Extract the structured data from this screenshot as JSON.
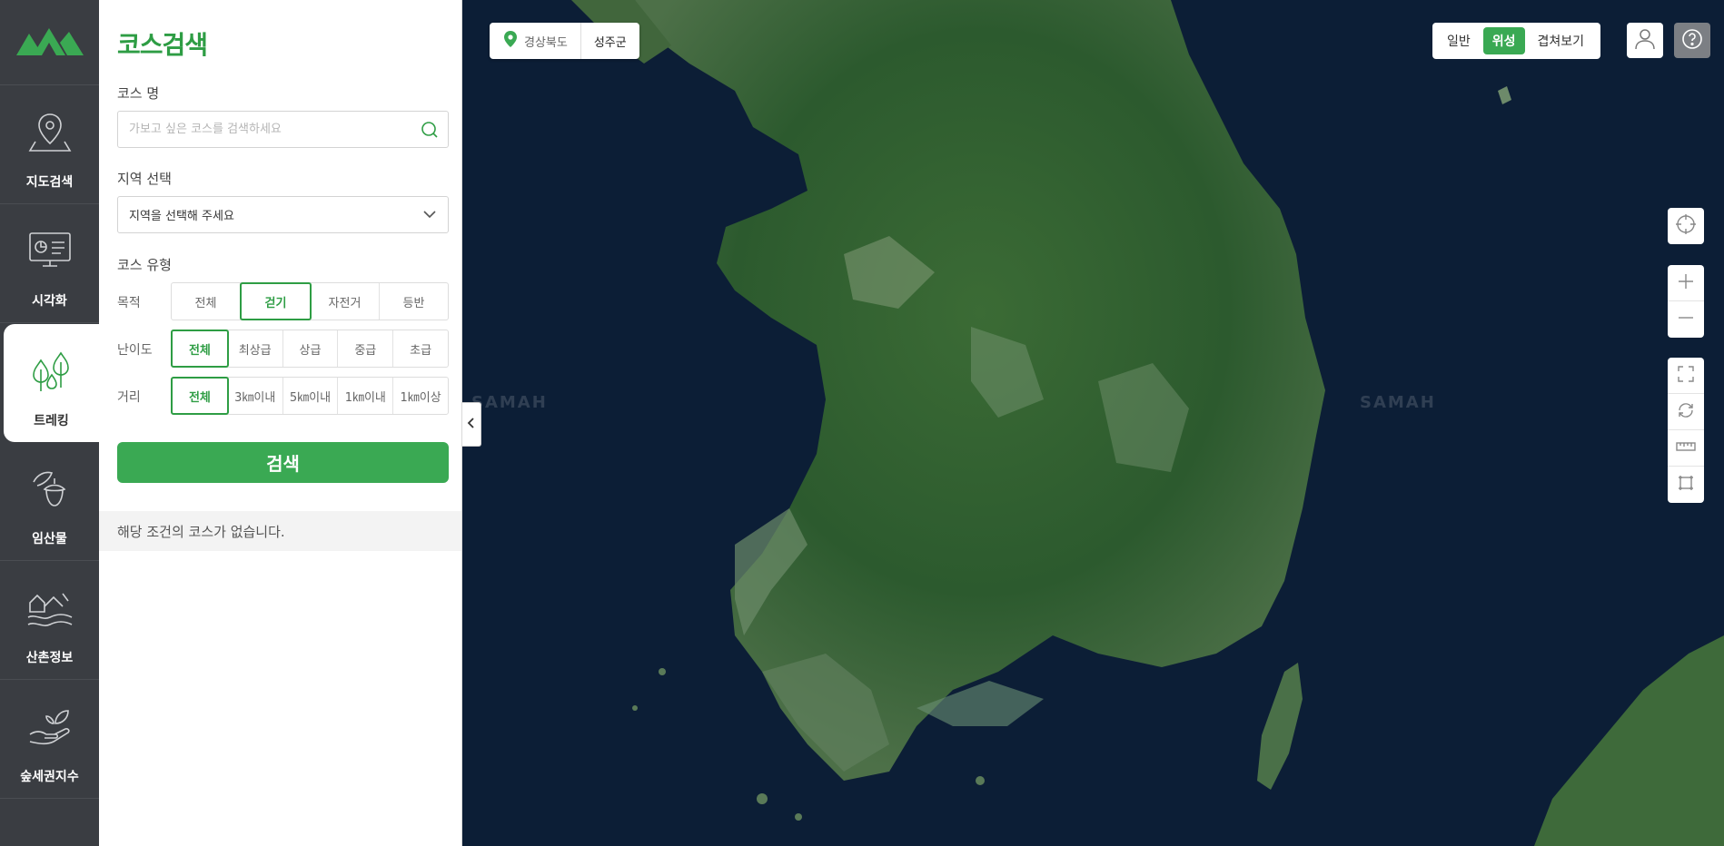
{
  "nav": {
    "items": [
      {
        "label": "지도검색",
        "icon": "map-pin-icon"
      },
      {
        "label": "시각화",
        "icon": "monitor-chart-icon"
      },
      {
        "label": "트레킹",
        "icon": "trees-icon"
      },
      {
        "label": "임산물",
        "icon": "acorn-icon"
      },
      {
        "label": "산촌정보",
        "icon": "village-icon"
      },
      {
        "label": "숲세권지수",
        "icon": "hand-leaf-icon"
      }
    ],
    "active": "트레킹"
  },
  "panel": {
    "title": "코스검색",
    "course_name_label": "코스 명",
    "course_name_placeholder": "가보고 싶은 코스를 검색하세요",
    "region_label": "지역 선택",
    "region_value": "지역을 선택해 주세요",
    "course_type_label": "코스 유형",
    "purpose": {
      "label": "목적",
      "options": [
        "전체",
        "걷기",
        "자전거",
        "등반"
      ],
      "selected": "걷기"
    },
    "difficulty": {
      "label": "난이도",
      "options": [
        "전체",
        "최상급",
        "상급",
        "중급",
        "초급"
      ],
      "selected": "전체"
    },
    "distance": {
      "label": "거리",
      "options": [
        "전체",
        "3㎞이내",
        "5㎞이내",
        "1㎞이내",
        "1㎞이상"
      ],
      "selected": "전체"
    },
    "search_button": "검색",
    "result_text": "해당 조건의 코스가 없습니다."
  },
  "map": {
    "breadcrumb": [
      "경상북도",
      "성주군"
    ],
    "types": [
      "일반",
      "위성",
      "겹쳐보기"
    ],
    "selected_type": "위성",
    "watermark": "SAMAH"
  },
  "colors": {
    "accent": "#3aa953",
    "nav_bg": "#3a3d42",
    "sea": "#0c1e36",
    "land": "#2f5a30"
  }
}
